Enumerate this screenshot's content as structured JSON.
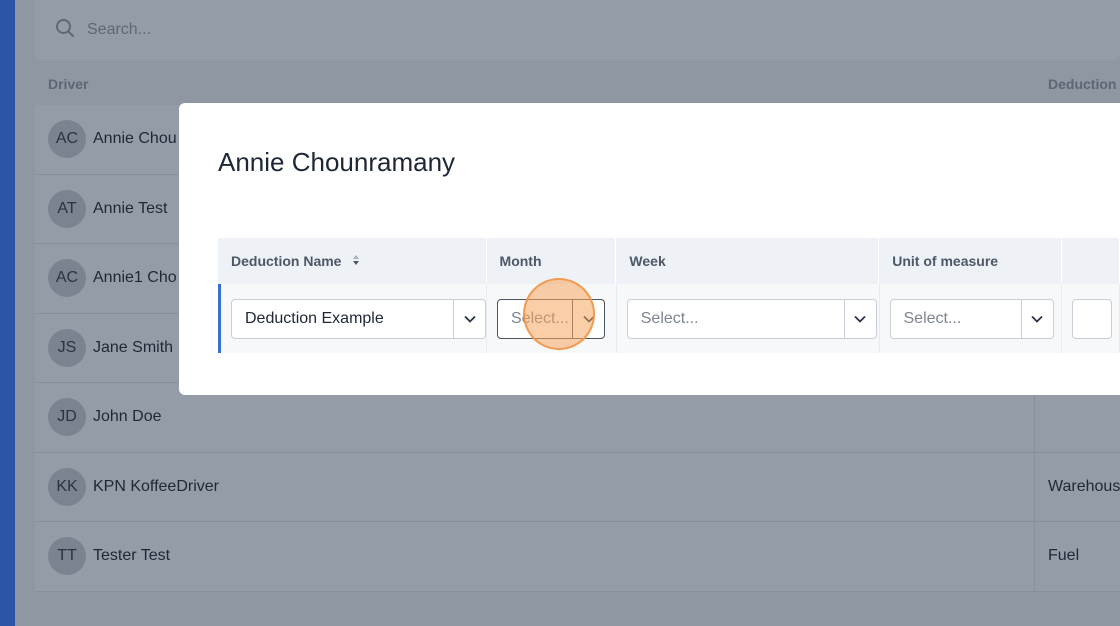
{
  "search": {
    "placeholder": "Search..."
  },
  "table": {
    "headers": {
      "driver": "Driver",
      "deduction": "Deduction"
    },
    "rows": [
      {
        "initials": "AC",
        "name": "Annie Chou",
        "deduction": ""
      },
      {
        "initials": "AT",
        "name": "Annie Test",
        "deduction": ""
      },
      {
        "initials": "AC",
        "name": "Annie1 Cho",
        "deduction": ""
      },
      {
        "initials": "JS",
        "name": "Jane Smith",
        "deduction": ""
      },
      {
        "initials": "JD",
        "name": "John Doe",
        "deduction": ""
      },
      {
        "initials": "KK",
        "name": "KPN KoffeeDriver",
        "deduction": "Warehous"
      },
      {
        "initials": "TT",
        "name": "Tester Test",
        "deduction": "Fuel"
      }
    ]
  },
  "modal": {
    "title": "Annie Chounramany",
    "columns": {
      "deduction_name": "Deduction Name",
      "month": "Month",
      "week": "Week",
      "unit": "Unit of measure"
    },
    "row": {
      "deduction_name": "Deduction Example",
      "month_placeholder": "Select...",
      "week_placeholder": "Select...",
      "unit_placeholder": "Select..."
    }
  },
  "colors": {
    "accent": "#3a6fcf",
    "overlay": "#8f97a3",
    "click_highlight": "#f5a55f"
  }
}
